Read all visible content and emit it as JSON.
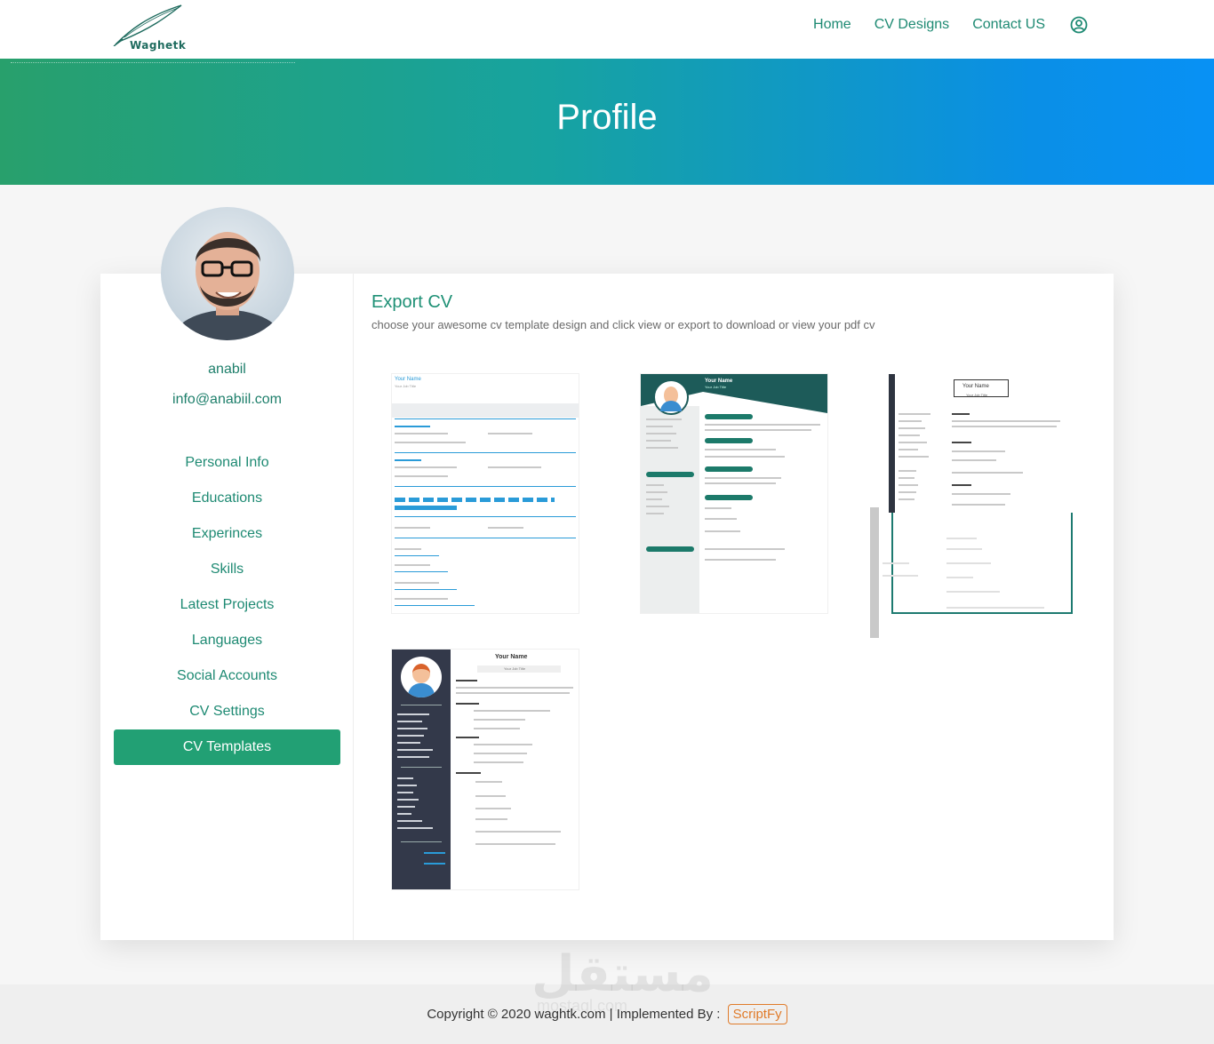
{
  "brand": {
    "name": "Waghetk"
  },
  "nav": {
    "items": [
      "Home",
      "CV Designs",
      "Contact US"
    ],
    "user_icon": "user-circle-icon"
  },
  "hero": {
    "title": "Profile"
  },
  "profile": {
    "name": "anabil",
    "email": "info@anabiil.com"
  },
  "menu": {
    "items": [
      "Personal Info",
      "Educations",
      "Experinces",
      "Skills",
      "Latest Projects",
      "Languages",
      "Social Accounts",
      "CV Settings",
      "CV Templates"
    ],
    "active": "CV Templates"
  },
  "export": {
    "title": "Export CV",
    "description": "choose your awesome cv template design and click view or export to download or view your pdf cv"
  },
  "templates": [
    {
      "heading": "Your Name",
      "sub": "Your Job Title"
    },
    {
      "heading": "Your Name",
      "sub": "Your Job Title"
    },
    {
      "heading": "Your Name",
      "sub": "Your Job Title"
    },
    {
      "heading": "Your Name",
      "sub": "Your Job Title"
    }
  ],
  "footer": {
    "copyright": "Copyright © 2020 waghtk.com | Implemented By :",
    "author": "ScriptFy",
    "watermark": "مستقل",
    "watermark_sub": "mostaql.com"
  },
  "colors": {
    "accent": "#22a074",
    "link": "#1e8a73",
    "hero_start": "#28a06c",
    "hero_end": "#0891f5",
    "author_border": "#e07b2a"
  }
}
